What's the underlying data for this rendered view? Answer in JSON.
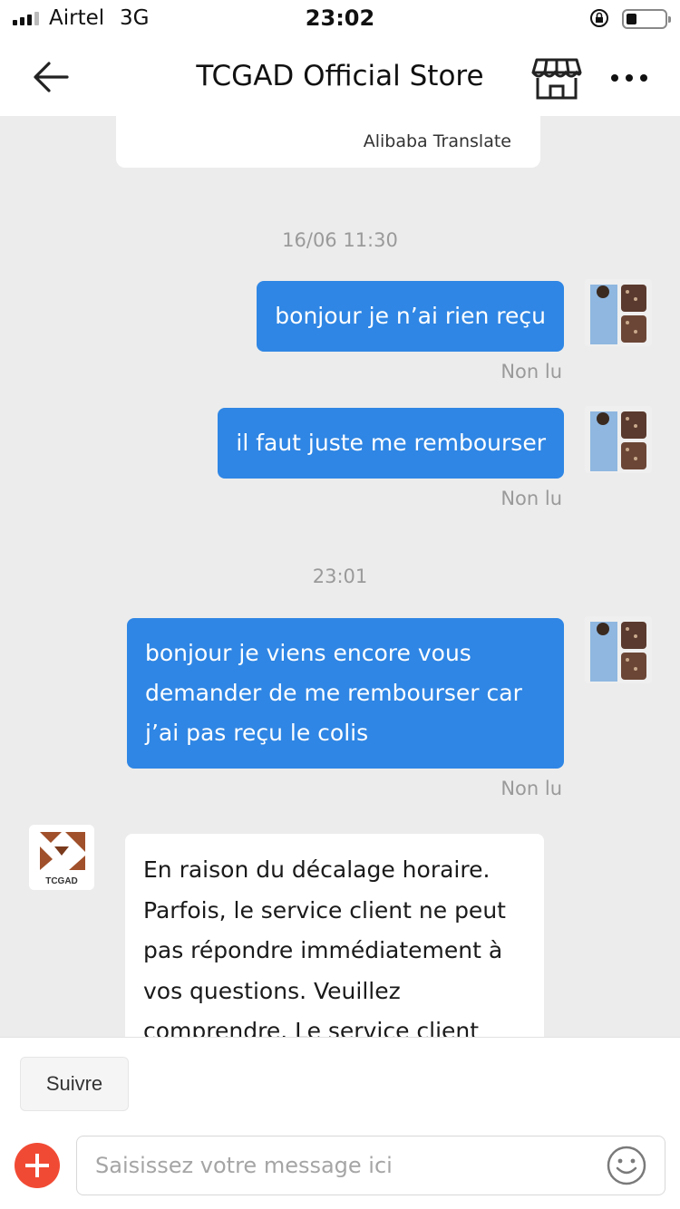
{
  "status_bar": {
    "carrier": "Airtel",
    "network": "3G",
    "time": "23:02"
  },
  "header": {
    "title": "TCGAD Official Store"
  },
  "chat": {
    "translate_label": "Alibaba Translate",
    "messages": [
      {
        "type": "timestamp",
        "text": "16/06 11:30"
      },
      {
        "type": "outgoing",
        "text": "bonjour je n’ai rien reçu",
        "status": "Non lu"
      },
      {
        "type": "outgoing",
        "text": "il faut juste me rembourser",
        "status": "Non lu"
      },
      {
        "type": "timestamp",
        "text": "23:01"
      },
      {
        "type": "outgoing",
        "text": "bonjour je viens encore vous demander de me rembourser car j’ai pas reçu le colis",
        "status": "Non lu"
      },
      {
        "type": "incoming",
        "text": "En raison du décalage horaire. Parfois, le service client ne peut pas répondre immédiatement à vos questions. Veuillez comprendre. Le service client"
      }
    ],
    "store_logo_text": "TCGAD"
  },
  "footer": {
    "follow_label": "Suivre",
    "input_placeholder": "Saisissez votre message ici"
  },
  "colors": {
    "outgoing_bubble": "#2f86e4",
    "add_button": "#f14a34",
    "chat_background": "#ececec"
  },
  "icons": [
    "back-arrow-icon",
    "store-icon",
    "more-icon",
    "lock-rotation-icon",
    "battery-icon",
    "add-icon",
    "emoji-icon"
  ]
}
